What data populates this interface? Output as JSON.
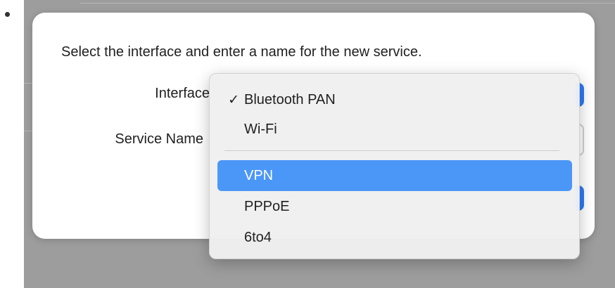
{
  "dialog": {
    "prompt": "Select the interface and enter a name for the new service.",
    "interface_label": "Interface",
    "service_name_label": "Service Name"
  },
  "menu": {
    "checkmark": "✓",
    "items": [
      {
        "label": "Bluetooth PAN",
        "checked": true,
        "selected": false
      },
      {
        "label": "Wi-Fi",
        "checked": false,
        "selected": false
      },
      {
        "label": "VPN",
        "checked": false,
        "selected": true
      },
      {
        "label": "PPPoE",
        "checked": false,
        "selected": false
      },
      {
        "label": "6to4",
        "checked": false,
        "selected": false
      }
    ]
  },
  "colors": {
    "accent": "#2f7bf6",
    "highlight": "#4b97f8"
  }
}
